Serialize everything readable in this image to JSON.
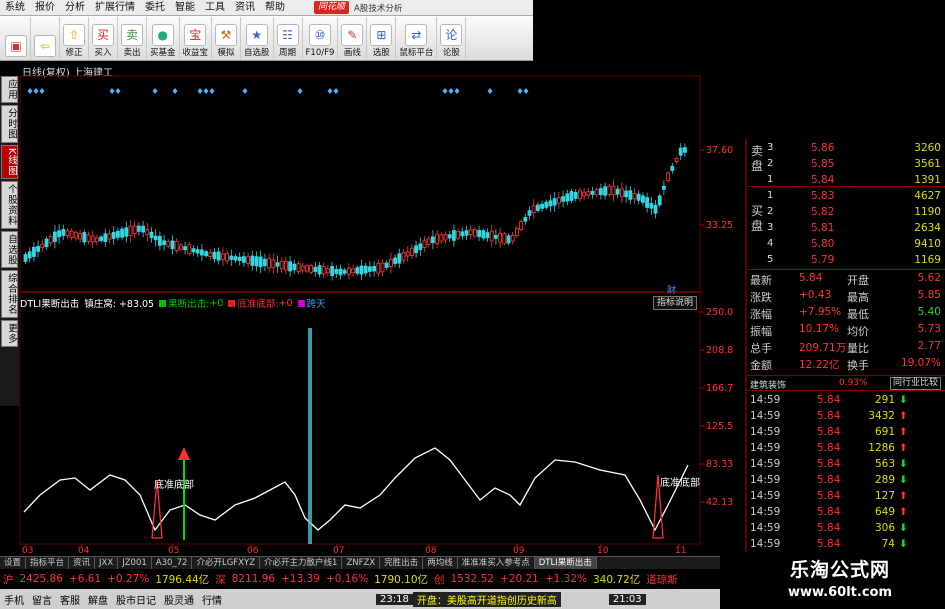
{
  "menu": [
    "系统",
    "报价",
    "分析",
    "扩展行情",
    "委托",
    "智能",
    "工具",
    "资讯",
    "帮助"
  ],
  "logo": "同花顺",
  "logo_sub": "A股技术分析",
  "toolbar": [
    {
      "icon": "▣",
      "label": "",
      "color": "#c33"
    },
    {
      "icon": "⇦",
      "label": "",
      "color": "#e6a817"
    },
    {
      "icon": "⇧",
      "label": "修正",
      "color": "#e6a817"
    },
    {
      "icon": "买",
      "label": "买入",
      "color": "#d22"
    },
    {
      "icon": "卖",
      "label": "卖出",
      "color": "#393"
    },
    {
      "icon": "●",
      "label": "买基金",
      "color": "#2a7"
    },
    {
      "icon": "宝",
      "label": "收益宝",
      "color": "#d22"
    },
    {
      "icon": "⚒",
      "label": "模拟",
      "color": "#c60"
    },
    {
      "icon": "★",
      "label": "自选股",
      "color": "#36c"
    },
    {
      "icon": "☷",
      "label": "周期",
      "color": "#36c"
    },
    {
      "icon": "⑩",
      "label": "F10/F9",
      "color": "#36c"
    },
    {
      "icon": "✎",
      "label": "画线",
      "color": "#c33"
    },
    {
      "icon": "⊞",
      "label": "选股",
      "color": "#36c"
    },
    {
      "icon": "⇄",
      "label": "鼠标平台",
      "color": "#36c"
    },
    {
      "icon": "论",
      "label": "论股",
      "color": "#36c"
    }
  ],
  "chart_title": "日线(复权)  上海建工",
  "vtabs": [
    {
      "label": "应用",
      "active": false
    },
    {
      "label": "分时图",
      "active": false
    },
    {
      "label": "K线图",
      "active": true
    },
    {
      "label": "个股资料",
      "active": false
    },
    {
      "label": "自选股",
      "active": false
    },
    {
      "label": "综合排名",
      "active": false
    },
    {
      "label": "更多",
      "active": false
    }
  ],
  "price_axis": [
    "37.60",
    "33.25"
  ],
  "ind_axis": [
    "250.0",
    "208.8",
    "166.7",
    "125.5",
    "83.33",
    "42.13"
  ],
  "cai_label": "财",
  "x_dates": [
    "03",
    "04",
    "05",
    "06",
    "07",
    "08",
    "09",
    "10",
    "11"
  ],
  "indicator": {
    "name": "DTLI果断出击",
    "item1": "镇庄窝: +83.05",
    "item2_label": "果断出击:",
    "item2_value": "+0",
    "item3_label": "底准底部:",
    "item3_value": "+0",
    "item4": "跨天",
    "help": "指标说明",
    "annot1": "底准底部",
    "annot2": "底准底部",
    "color_line": "#ffffff",
    "color_green": "#00e000",
    "color_red": "#ff3030",
    "color_cyan": "#55cccc"
  },
  "orderbook": {
    "sell_label": "卖盘",
    "buy_label": "买盘",
    "sell": [
      {
        "lvl": "3",
        "price": "5.86",
        "vol": "3260"
      },
      {
        "lvl": "2",
        "price": "5.85",
        "vol": "3561"
      },
      {
        "lvl": "1",
        "price": "5.84",
        "vol": "1391"
      }
    ],
    "buy": [
      {
        "lvl": "1",
        "price": "5.83",
        "vol": "4627"
      },
      {
        "lvl": "2",
        "price": "5.82",
        "vol": "1190"
      },
      {
        "lvl": "3",
        "price": "5.81",
        "vol": "2634"
      },
      {
        "lvl": "4",
        "price": "5.80",
        "vol": "9410"
      },
      {
        "lvl": "5",
        "price": "5.79",
        "vol": "1169"
      }
    ]
  },
  "quote": [
    {
      "l": "最新",
      "v1": "5.84",
      "l2": "开盘",
      "v2": "5.62"
    },
    {
      "l": "涨跌",
      "v1": "+0.43",
      "l2": "最高",
      "v2": "5.85"
    },
    {
      "l": "涨幅",
      "v1": "+7.95%",
      "l2": "最低",
      "v2": "5.40"
    },
    {
      "l": "振幅",
      "v1": "10.17%",
      "l2": "均价",
      "v2": "5.73"
    },
    {
      "l": "总手",
      "v1": "209.71万",
      "l2": "量比",
      "v2": "2.77"
    },
    {
      "l": "金额",
      "v1": "12.22亿",
      "l2": "换手",
      "v2": "19.07%"
    }
  ],
  "sector": {
    "name": "建筑装饰",
    "pct": "0.93%",
    "btn": "同行业比较"
  },
  "ticks": [
    {
      "t": "14:59",
      "p": "5.84",
      "v": "291",
      "d": "down"
    },
    {
      "t": "14:59",
      "p": "5.84",
      "v": "3432",
      "d": "up"
    },
    {
      "t": "14:59",
      "p": "5.84",
      "v": "691",
      "d": "up"
    },
    {
      "t": "14:59",
      "p": "5.84",
      "v": "1286",
      "d": "up"
    },
    {
      "t": "14:59",
      "p": "5.84",
      "v": "563",
      "d": "down"
    },
    {
      "t": "14:59",
      "p": "5.84",
      "v": "289",
      "d": "down"
    },
    {
      "t": "14:59",
      "p": "5.84",
      "v": "127",
      "d": "up"
    },
    {
      "t": "14:59",
      "p": "5.84",
      "v": "649",
      "d": "up"
    },
    {
      "t": "14:59",
      "p": "5.84",
      "v": "306",
      "d": "down"
    },
    {
      "t": "14:59",
      "p": "5.84",
      "v": "74",
      "d": "down"
    }
  ],
  "bottom_tabs": [
    "设置",
    "指标平台",
    "资讯",
    "JXX",
    "JZ001",
    "A30_72",
    "介必开LGFXYZ",
    "介必开主力散户线1",
    "ZNFZX",
    "完胜出击",
    "两均线",
    "准准准买入参考点",
    "DTLI果断出击"
  ],
  "index_bar": [
    {
      "t": "沪",
      "c": "#f33"
    },
    {
      "t": "2425.86",
      "c": "#f33"
    },
    {
      "t": "+6.61",
      "c": "#f33"
    },
    {
      "t": "+0.27%",
      "c": "#f33"
    },
    {
      "t": "1796.44亿",
      "c": "#dd0"
    },
    {
      "t": "深",
      "c": "#f33"
    },
    {
      "t": "8211.96",
      "c": "#f33"
    },
    {
      "t": "+13.39",
      "c": "#f33"
    },
    {
      "t": "+0.16%",
      "c": "#f33"
    },
    {
      "t": "1790.10亿",
      "c": "#dd0"
    },
    {
      "t": "创",
      "c": "#f33"
    },
    {
      "t": "1532.52",
      "c": "#f33"
    },
    {
      "t": "+20.21",
      "c": "#f33"
    },
    {
      "t": "+1.32%",
      "c": "#f33"
    },
    {
      "t": "340.72亿",
      "c": "#dd0"
    },
    {
      "t": "道琼斯",
      "c": "#f33"
    }
  ],
  "status_bar": [
    "手机",
    "留言",
    "客服",
    "解盘",
    "股市日记",
    "股灵通",
    "行情"
  ],
  "status_time": "23:18",
  "status_news": "开盘：美股高开道指创历史新高",
  "status_time2": "21:03",
  "watermark_1": "乐淘公式网",
  "watermark_2": "www.60lt.com"
}
